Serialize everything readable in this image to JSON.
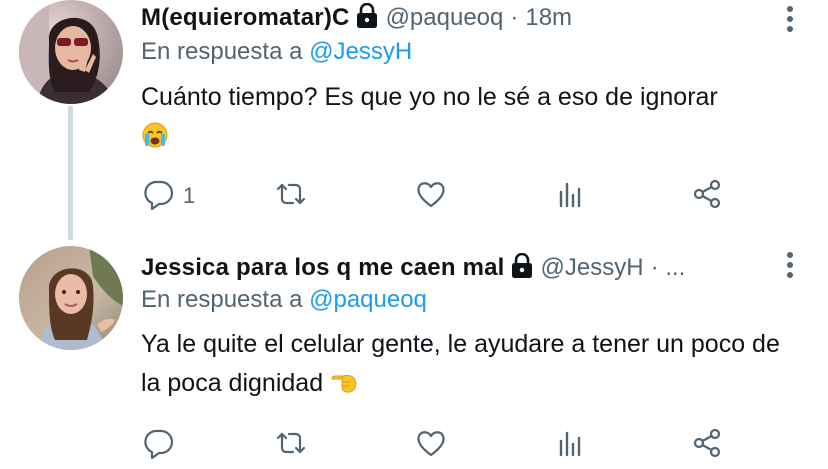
{
  "tweets": [
    {
      "display_name": "M(equieromatar)C",
      "handle": "@paqueoq",
      "separator": "·",
      "time": "18m",
      "reply_prefix": "En respuesta a",
      "reply_to": "@JessyH",
      "text": "Cuánto tiempo? Es que yo no le sé a eso de ignorar",
      "emoji": "loudly-crying-face",
      "reply_count": "1",
      "locked": true
    },
    {
      "display_name": "Jessica para los q me caen mal",
      "handle": "@JessyH",
      "separator": "· ...",
      "time": "",
      "reply_prefix": "En respuesta a",
      "reply_to": "@paqueoq",
      "text": "Ya le quite el celular gente, le ayudare a tener un poco de la poca dignidad",
      "emoji": "backhand-index-pointing-left",
      "reply_count": "",
      "locked": true
    }
  ],
  "icons": {
    "lock": "lock-icon",
    "more": "more-vertical-icon",
    "reply": "reply-icon",
    "retweet": "retweet-icon",
    "like": "heart-icon",
    "views": "analytics-icon",
    "share": "share-icon"
  },
  "colors": {
    "link": "#1d9bf0",
    "secondary_text": "#536471",
    "primary_text": "#0f1419",
    "thread_line": "#cfd9de"
  }
}
